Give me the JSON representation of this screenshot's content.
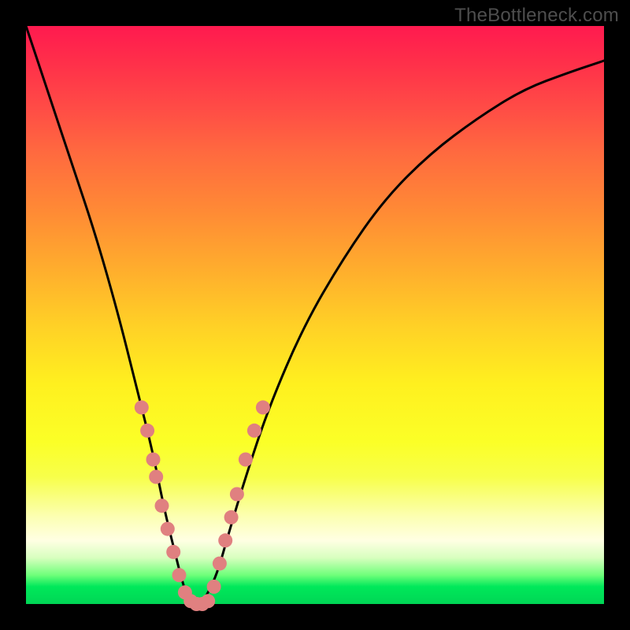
{
  "watermark": "TheBottleneck.com",
  "chart_data": {
    "type": "line",
    "title": "",
    "xlabel": "",
    "ylabel": "",
    "xlim": [
      0,
      100
    ],
    "ylim": [
      0,
      100
    ],
    "grid": false,
    "legend": false,
    "series": [
      {
        "name": "bottleneck-curve",
        "color": "#000000",
        "x": [
          0,
          4,
          8,
          12,
          16,
          19,
          22,
          24,
          26,
          27,
          28,
          29,
          30,
          31,
          33,
          35,
          38,
          42,
          48,
          55,
          62,
          70,
          78,
          86,
          94,
          100
        ],
        "y": [
          100,
          88,
          76,
          64,
          50,
          38,
          26,
          16,
          8,
          4,
          1,
          0,
          0,
          1,
          5,
          12,
          22,
          34,
          48,
          60,
          70,
          78,
          84,
          89,
          92,
          94
        ]
      }
    ],
    "markers": [
      {
        "name": "left-branch-dots",
        "color": "#e08080",
        "points": [
          {
            "x": 20,
            "y": 34
          },
          {
            "x": 21,
            "y": 30
          },
          {
            "x": 22,
            "y": 25
          },
          {
            "x": 22.5,
            "y": 22
          },
          {
            "x": 23.5,
            "y": 17
          },
          {
            "x": 24.5,
            "y": 13
          },
          {
            "x": 25.5,
            "y": 9
          },
          {
            "x": 26.5,
            "y": 5
          },
          {
            "x": 27.5,
            "y": 2
          }
        ]
      },
      {
        "name": "trough-dots",
        "color": "#e08080",
        "points": [
          {
            "x": 28.5,
            "y": 0.5
          },
          {
            "x": 29.5,
            "y": 0
          },
          {
            "x": 30.5,
            "y": 0
          },
          {
            "x": 31.5,
            "y": 0.5
          }
        ]
      },
      {
        "name": "right-branch-dots",
        "color": "#e08080",
        "points": [
          {
            "x": 32.5,
            "y": 3
          },
          {
            "x": 33.5,
            "y": 7
          },
          {
            "x": 34.5,
            "y": 11
          },
          {
            "x": 35.5,
            "y": 15
          },
          {
            "x": 36.5,
            "y": 19
          },
          {
            "x": 38,
            "y": 25
          },
          {
            "x": 39.5,
            "y": 30
          },
          {
            "x": 41,
            "y": 34
          }
        ]
      }
    ]
  }
}
